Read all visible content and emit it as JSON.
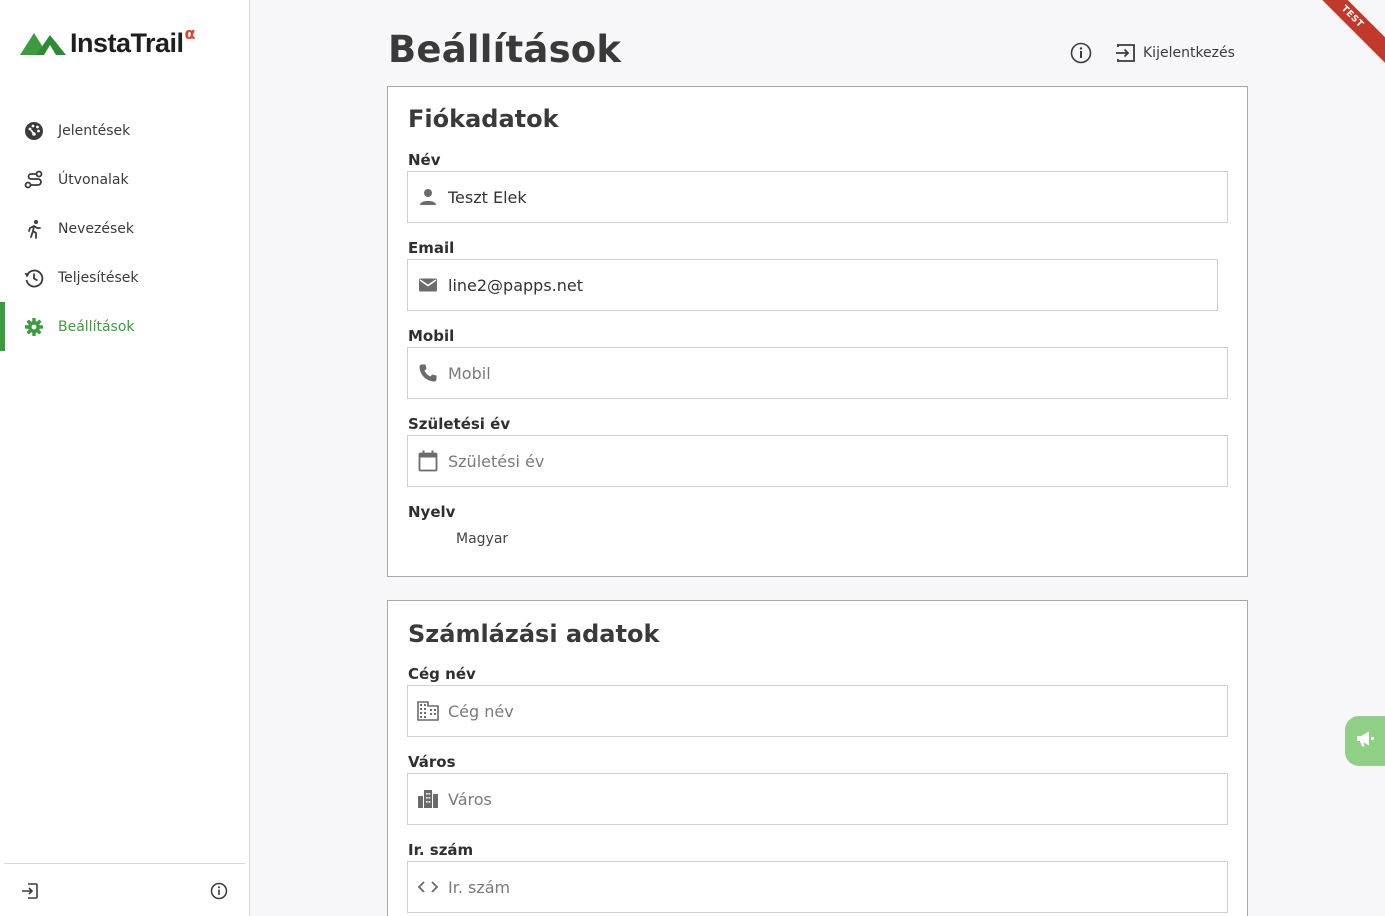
{
  "app": {
    "logo_text": "InstaTrail",
    "logo_badge": "α",
    "env_ribbon": "TEST"
  },
  "sidebar": {
    "items": [
      {
        "label": "Jelentések",
        "icon": "dashboard-gauge-icon",
        "active": false
      },
      {
        "label": "Útvonalak",
        "icon": "route-icon",
        "active": false
      },
      {
        "label": "Nevezések",
        "icon": "runner-icon",
        "active": false
      },
      {
        "label": "Teljesítések",
        "icon": "history-icon",
        "active": false
      },
      {
        "label": "Beállítások",
        "icon": "gear-icon",
        "active": true
      }
    ]
  },
  "header": {
    "title": "Beállítások",
    "logout_label": "Kijelentkezés"
  },
  "account": {
    "title": "Fiókadatok",
    "name_label": "Név",
    "name_value": "Teszt Elek",
    "email_label": "Email",
    "email_value": "line2@papps.net",
    "mobile_label": "Mobil",
    "mobile_placeholder": "Mobil",
    "birth_label": "Születési év",
    "birth_placeholder": "Születési év",
    "language_label": "Nyelv",
    "language_value": "Magyar"
  },
  "billing": {
    "title": "Számlázási adatok",
    "company_label": "Cég név",
    "company_placeholder": "Cég név",
    "city_label": "Város",
    "city_placeholder": "Város",
    "zip_label": "Ir. szám",
    "zip_placeholder": "Ir. szám"
  },
  "colors": {
    "accent": "#3d9a41",
    "ribbon": "#c0392b",
    "logo_badge": "#e0462f",
    "feedback": "#8fcf86"
  }
}
